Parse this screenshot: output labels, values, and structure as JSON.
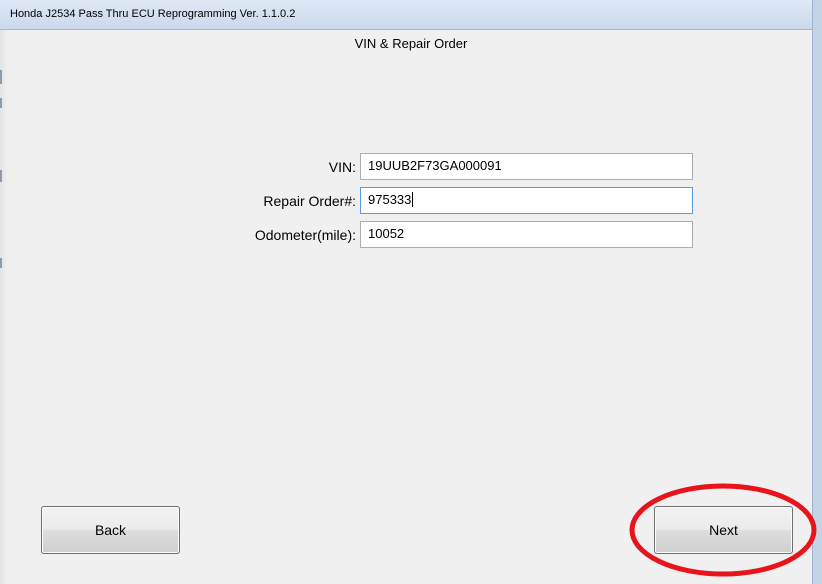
{
  "window": {
    "title": "Honda J2534 Pass Thru ECU Reprogramming Ver. 1.1.0.2"
  },
  "page": {
    "heading": "VIN & Repair Order"
  },
  "form": {
    "vin": {
      "label": "VIN:",
      "value": "19UUB2F73GA000091"
    },
    "repair_order": {
      "label": "Repair Order#:",
      "value": "975333"
    },
    "odometer": {
      "label": "Odometer(mile):",
      "value": "10052"
    }
  },
  "buttons": {
    "back_label": "Back",
    "next_label": "Next"
  },
  "annotation": {
    "shape": "ellipse",
    "color": "#e8141c",
    "target": "next-button"
  }
}
